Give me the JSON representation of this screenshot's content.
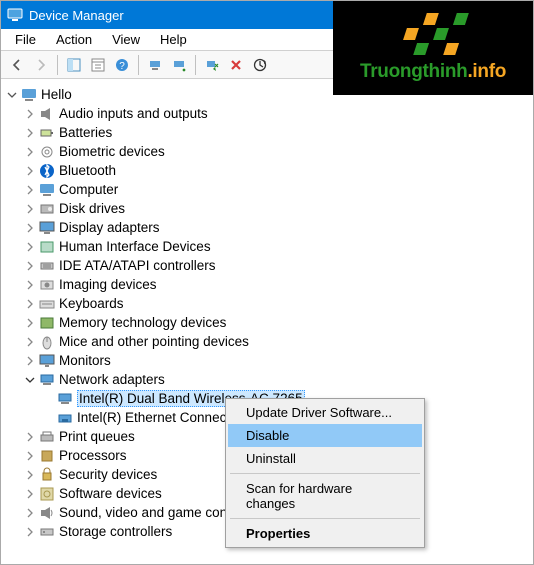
{
  "window": {
    "title": "Device Manager"
  },
  "menubar": {
    "file": "File",
    "action": "Action",
    "view": "View",
    "help": "Help"
  },
  "tree": {
    "root": "Hello",
    "items": [
      "Audio inputs and outputs",
      "Batteries",
      "Biometric devices",
      "Bluetooth",
      "Computer",
      "Disk drives",
      "Display adapters",
      "Human Interface Devices",
      "IDE ATA/ATAPI controllers",
      "Imaging devices",
      "Keyboards",
      "Memory technology devices",
      "Mice and other pointing devices",
      "Monitors",
      "Network adapters",
      "Print queues",
      "Processors",
      "Security devices",
      "Software devices",
      "Sound, video and game controllers",
      "Storage controllers"
    ],
    "network_children": [
      "Intel(R) Dual Band Wireless-AC 7265",
      "Intel(R) Ethernet Connection"
    ]
  },
  "context_menu": {
    "update": "Update Driver Software...",
    "disable": "Disable",
    "uninstall": "Uninstall",
    "scan": "Scan for hardware changes",
    "properties": "Properties"
  },
  "watermark": {
    "brand1": "Truongthinh",
    "brand2": ".info"
  }
}
